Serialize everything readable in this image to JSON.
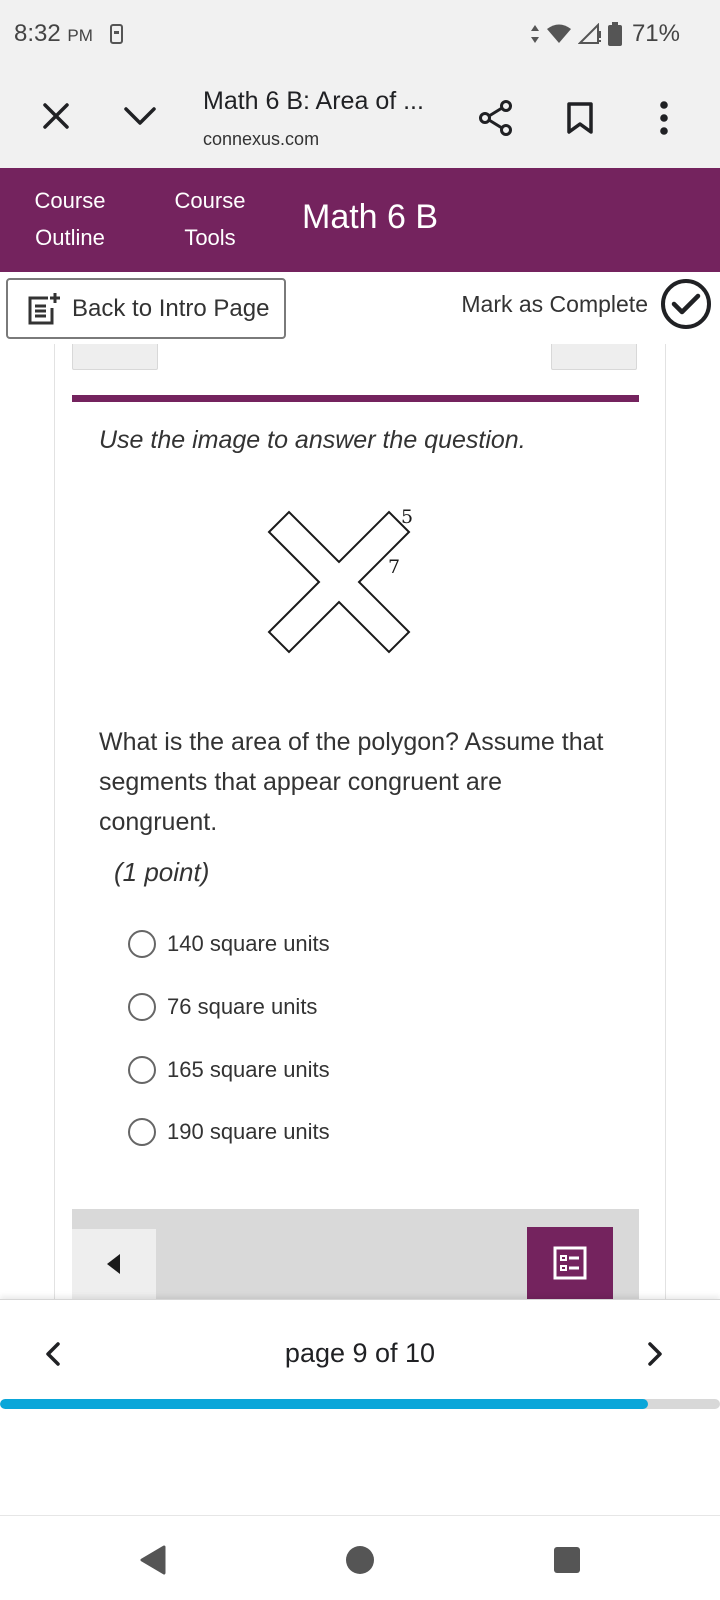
{
  "status_bar": {
    "time": "8:32",
    "ampm": "PM",
    "battery": "71%"
  },
  "browser": {
    "title": "Math 6 B: Area of ...",
    "url": "connexus.com",
    "icons": [
      "close-icon",
      "chevron-down-icon",
      "share-icon",
      "bookmark-icon",
      "more-vert-icon"
    ]
  },
  "course_header": {
    "outline_line1": "Course",
    "outline_line2": "Outline",
    "tools_line1": "Course",
    "tools_line2": "Tools",
    "title": "Math 6 B",
    "color": "#74235e"
  },
  "intro_row": {
    "back_label": "Back to Intro Page",
    "mark_label": "Mark as Complete"
  },
  "question": {
    "instruction": "Use the image to answer the question.",
    "figure_labels": {
      "short_side": "5",
      "long_side": "7"
    },
    "text": "What is the area of the polygon? Assume that segments that appear congruent are congruent.",
    "points": "(1 point)",
    "options": [
      "140 square units",
      "76 square units",
      "165 square units",
      "190 square units"
    ]
  },
  "pager": {
    "label": "page 9 of 10",
    "progress_fraction": 0.9,
    "progress_color": "#0aa6d9"
  }
}
